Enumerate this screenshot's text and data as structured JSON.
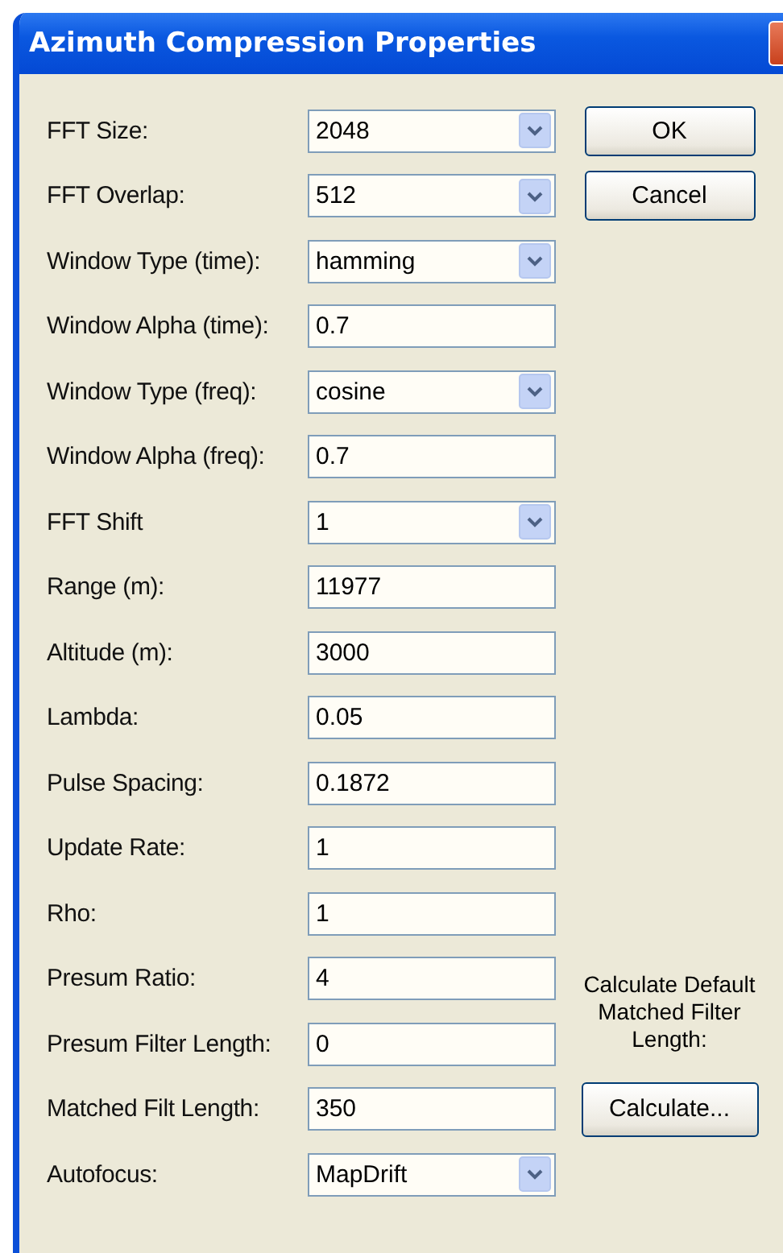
{
  "window": {
    "title": "Azimuth Compression Properties"
  },
  "fields": [
    {
      "label": "FFT Size:",
      "value": "2048",
      "kind": "combo"
    },
    {
      "label": "FFT Overlap:",
      "value": "512",
      "kind": "combo"
    },
    {
      "label": "Window Type (time):",
      "value": "hamming",
      "kind": "combo"
    },
    {
      "label": "Window Alpha (time):",
      "value": "0.7",
      "kind": "text"
    },
    {
      "label": "Window Type (freq):",
      "value": "cosine",
      "kind": "combo"
    },
    {
      "label": "Window Alpha (freq):",
      "value": "0.7",
      "kind": "text"
    },
    {
      "label": "FFT Shift",
      "value": "1",
      "kind": "combo"
    },
    {
      "label": "Range (m):",
      "value": "11977",
      "kind": "text"
    },
    {
      "label": "Altitude (m):",
      "value": "3000",
      "kind": "text"
    },
    {
      "label": "Lambda:",
      "value": "0.05",
      "kind": "text"
    },
    {
      "label": "Pulse Spacing:",
      "value": "0.1872",
      "kind": "text"
    },
    {
      "label": "Update Rate:",
      "value": "1",
      "kind": "text"
    },
    {
      "label": "Rho:",
      "value": "1",
      "kind": "text"
    },
    {
      "label": "Presum Ratio:",
      "value": "4",
      "kind": "text"
    },
    {
      "label": "Presum Filter Length:",
      "value": "0",
      "kind": "text"
    },
    {
      "label": "Matched Filt Length:",
      "value": "350",
      "kind": "text"
    },
    {
      "label": "Autofocus:",
      "value": "MapDrift",
      "kind": "combo"
    }
  ],
  "buttons": [
    "OK",
    "Cancel"
  ],
  "matched_filter": {
    "note": "Calculate Default Matched Filter Length:",
    "button": "Calculate..."
  }
}
